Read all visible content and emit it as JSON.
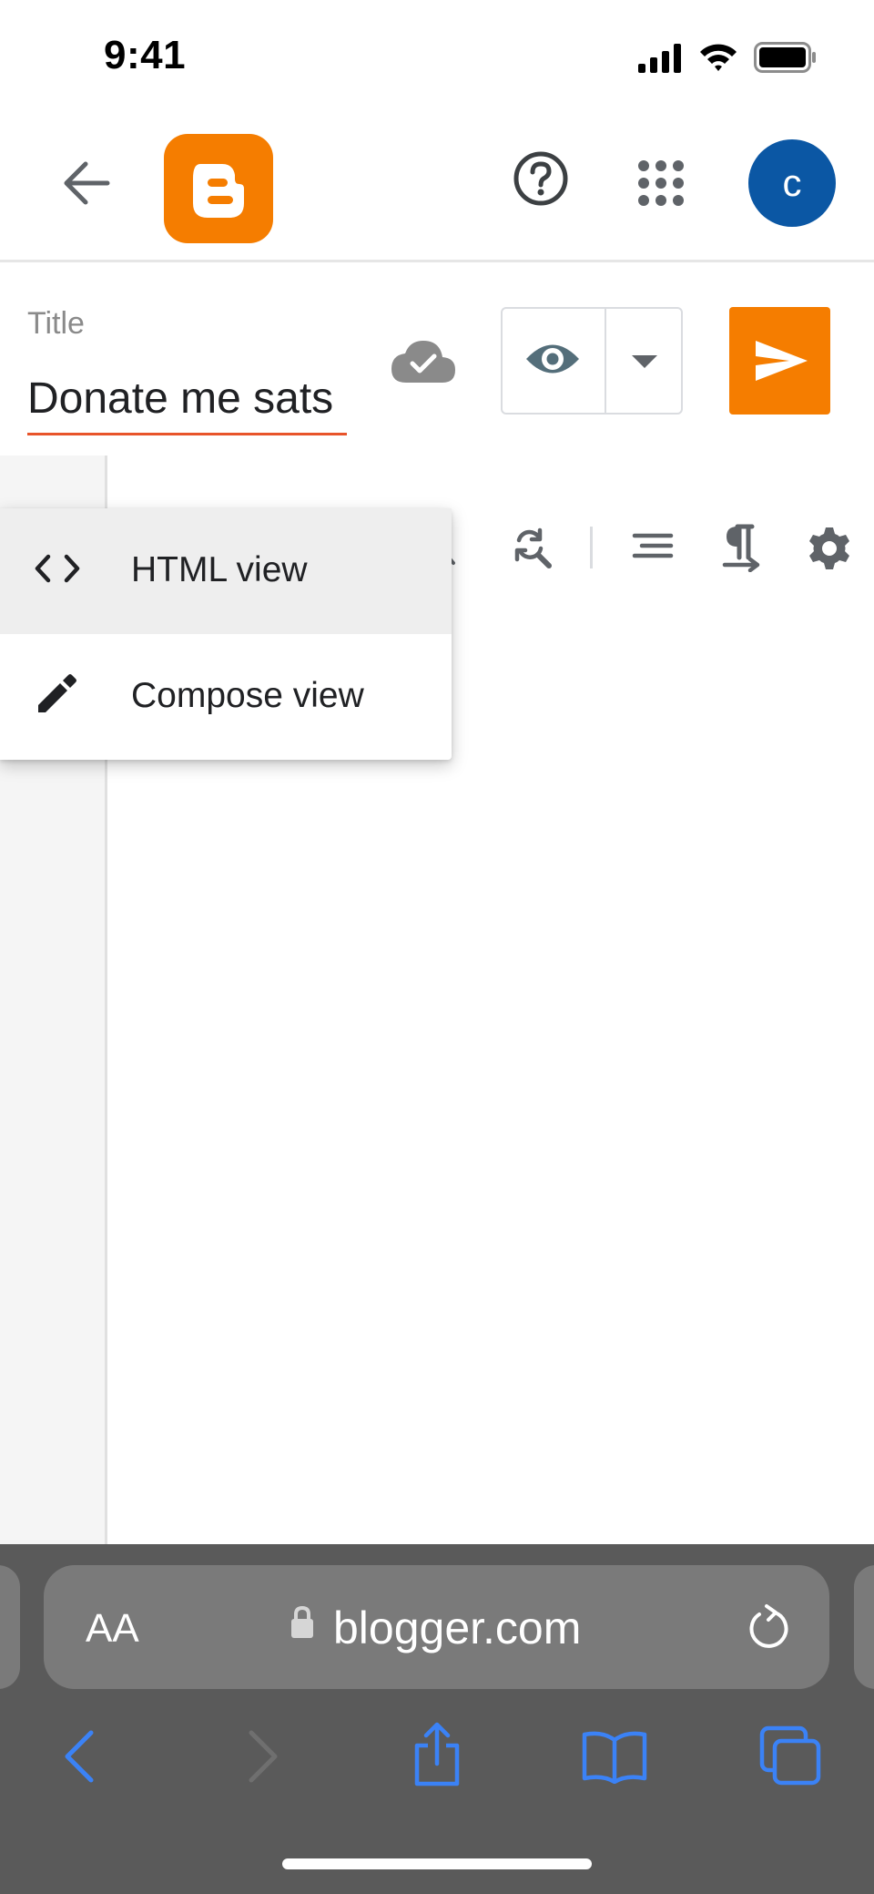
{
  "status_bar": {
    "time": "9:41"
  },
  "header": {
    "avatar_initial": "c"
  },
  "post": {
    "title_label": "Title",
    "title_value": "Donate me sats"
  },
  "view_menu": {
    "items": [
      {
        "label": "HTML view",
        "icon": "code-icon",
        "highlighted": true
      },
      {
        "label": "Compose view",
        "icon": "pencil-icon",
        "highlighted": false
      }
    ]
  },
  "browser": {
    "text_size_label": "AA",
    "url": "blogger.com"
  },
  "colors": {
    "accent": "#f57d00",
    "avatar": "#0b57a4",
    "title_underline": "#e8542a",
    "link_blue": "#3b82f6"
  }
}
